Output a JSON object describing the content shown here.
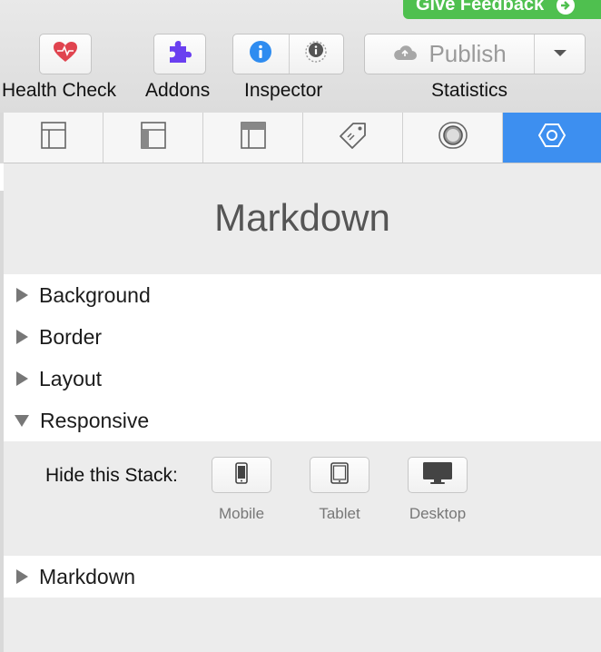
{
  "feedback": {
    "label": "Give Feedback"
  },
  "toolbar": {
    "health_check": "Health Check",
    "addons": "Addons",
    "inspector": "Inspector",
    "publish": "Publish",
    "statistics": "Statistics"
  },
  "title": "Markdown",
  "sections": {
    "background": "Background",
    "border": "Border",
    "layout": "Layout",
    "responsive": "Responsive",
    "markdown": "Markdown"
  },
  "responsive": {
    "hide_label": "Hide this Stack:",
    "mobile": "Mobile",
    "tablet": "Tablet",
    "desktop": "Desktop"
  },
  "colors": {
    "accent": "#3d8ff0",
    "feedback": "#4fc04f",
    "heart": "#e0444f",
    "addons": "#6a3ff0",
    "info": "#2f8cf0"
  }
}
